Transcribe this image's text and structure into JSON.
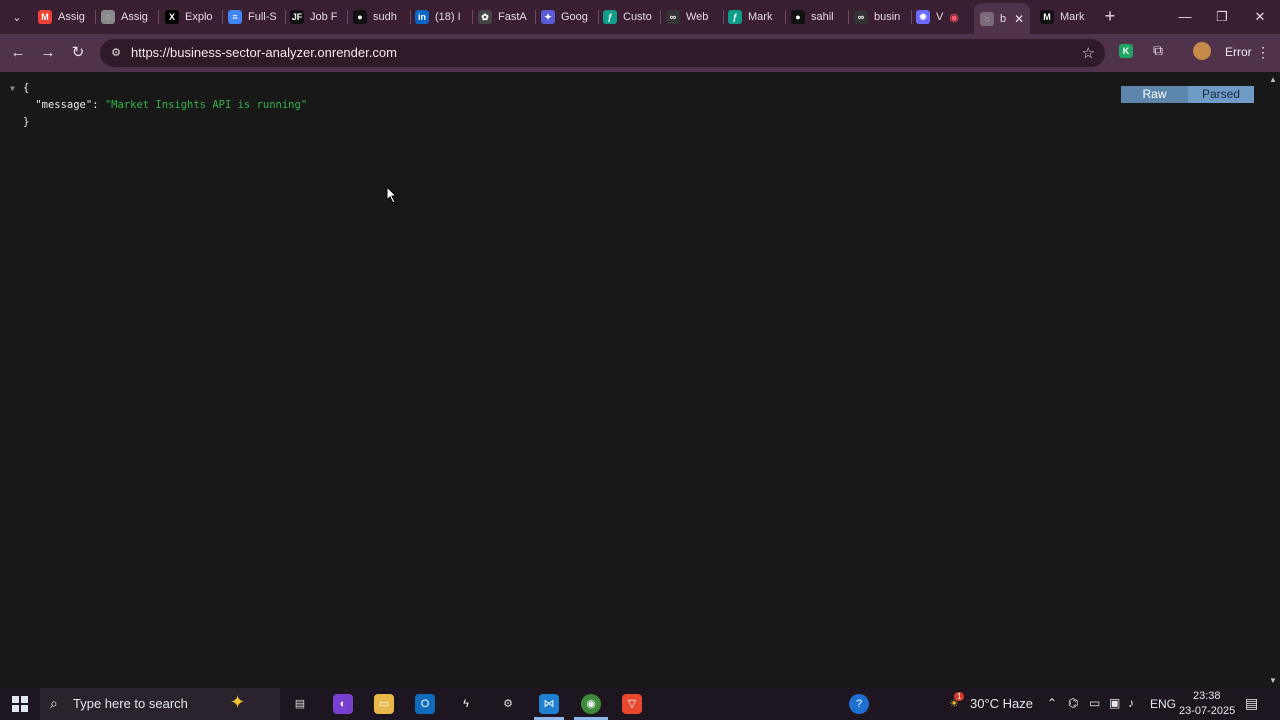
{
  "browser": {
    "tabs": [
      {
        "label": "Assig",
        "icon": "gmail-icon",
        "color": "#ea4335"
      },
      {
        "label": "Assig",
        "icon": "globe-icon",
        "color": "#8a8a8a"
      },
      {
        "label": "Explo",
        "icon": "x-icon",
        "color": "#000000"
      },
      {
        "label": "Full-S",
        "icon": "docs-icon",
        "color": "#4285f4"
      },
      {
        "label": "Job F",
        "icon": "jf-icon",
        "color": "#111111"
      },
      {
        "label": "sudh",
        "icon": "github-icon",
        "color": "#111111"
      },
      {
        "label": "(18) I",
        "icon": "linkedin-icon",
        "color": "#0a66c2"
      },
      {
        "label": "FastA",
        "icon": "openai-icon",
        "color": "#444444"
      },
      {
        "label": "Goog",
        "icon": "gemini-icon",
        "color": "#5b5bd6"
      },
      {
        "label": "Custo",
        "icon": "feather-icon",
        "color": "#0f9d8a"
      },
      {
        "label": "Web",
        "icon": "link-icon",
        "color": "#333333"
      },
      {
        "label": "Mark",
        "icon": "feather-icon",
        "color": "#0f9d8a"
      },
      {
        "label": "sahil",
        "icon": "github-icon",
        "color": "#111111"
      },
      {
        "label": "busin",
        "icon": "link-icon",
        "color": "#333333"
      },
      {
        "label": "V",
        "icon": "sparkle-icon",
        "color": "#6b6bff"
      }
    ],
    "active_tab": {
      "label": "b",
      "icon": "globe-icon",
      "close": "✕"
    },
    "after_tab": {
      "label": "Mark",
      "icon": "medium-icon",
      "icon_text": "M"
    },
    "new_tab": "+",
    "window": {
      "minimize": "—",
      "restore": "❐",
      "close": "✕"
    },
    "url": "https://business-sector-analyzer.onrender.com",
    "profile_status": "Error",
    "extension_letter": "K"
  },
  "viewer": {
    "raw_label": "Raw",
    "parsed_label": "Parsed",
    "open_brace": "{",
    "close_brace": "}",
    "key": "\"message\"",
    "colon": ": ",
    "value": "\"Market Insights API is running\""
  },
  "taskbar": {
    "search_placeholder": "Type here to search",
    "weather": "30°C Haze",
    "lang": "ENG",
    "time": "23:38",
    "date": "23-07-2025",
    "weather_badge": "1"
  }
}
